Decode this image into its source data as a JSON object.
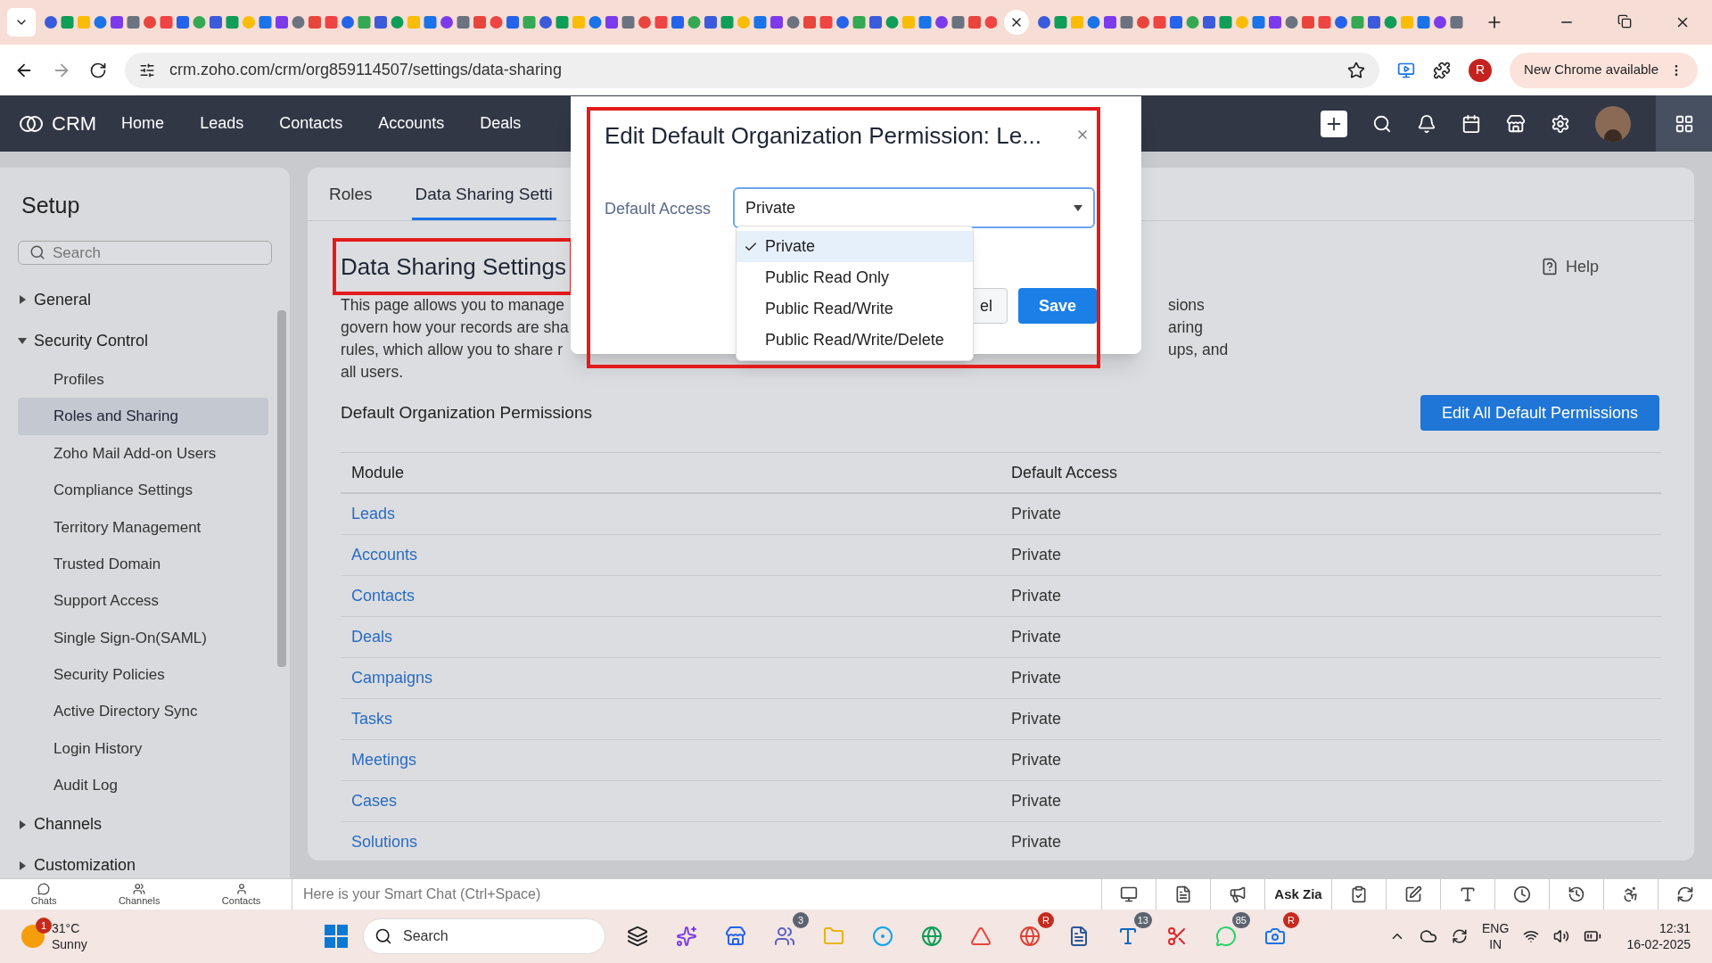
{
  "browser": {
    "url": "crm.zoho.com/crm/org859114507/settings/data-sharing",
    "update_label": "New Chrome available",
    "profile_initial": "R"
  },
  "app_nav": {
    "logo": "CRM",
    "items": [
      {
        "label": "Home"
      },
      {
        "label": "Leads"
      },
      {
        "label": "Contacts"
      },
      {
        "label": "Accounts"
      },
      {
        "label": "Deals"
      }
    ]
  },
  "sidebar": {
    "title": "Setup",
    "search_placeholder": "Search",
    "tree": [
      {
        "label": "General",
        "expanded": false
      },
      {
        "label": "Security Control",
        "expanded": true,
        "children": [
          {
            "label": "Profiles",
            "selected": false
          },
          {
            "label": "Roles and Sharing",
            "selected": true
          },
          {
            "label": "Zoho Mail Add-on Users",
            "selected": false
          },
          {
            "label": "Compliance Settings",
            "selected": false
          },
          {
            "label": "Territory Management",
            "selected": false
          },
          {
            "label": "Trusted Domain",
            "selected": false
          },
          {
            "label": "Support Access",
            "selected": false
          },
          {
            "label": "Single Sign-On(SAML)",
            "selected": false
          },
          {
            "label": "Security Policies",
            "selected": false
          },
          {
            "label": "Active Directory Sync",
            "selected": false
          },
          {
            "label": "Login History",
            "selected": false
          },
          {
            "label": "Audit Log",
            "selected": false
          }
        ]
      },
      {
        "label": "Channels",
        "expanded": false
      },
      {
        "label": "Customization",
        "expanded": false
      }
    ]
  },
  "content": {
    "tabs": [
      {
        "label": "Roles",
        "selected": false
      },
      {
        "label": "Data Sharing Setti",
        "selected": true
      }
    ],
    "heading": "Data Sharing Settings",
    "help": "Help",
    "description_left": [
      "This page allows you to manage",
      "govern how your records are sha",
      "rules, which allow you to share r",
      "all users."
    ],
    "description_right": [
      "sions",
      "aring",
      "ups, and"
    ],
    "section_title": "Default Organization Permissions",
    "edit_button": "Edit All Default Permissions",
    "table": {
      "columns": [
        "Module",
        "Default Access"
      ],
      "rows": [
        {
          "module": "Leads",
          "access": "Private"
        },
        {
          "module": "Accounts",
          "access": "Private"
        },
        {
          "module": "Contacts",
          "access": "Private"
        },
        {
          "module": "Deals",
          "access": "Private"
        },
        {
          "module": "Campaigns",
          "access": "Private"
        },
        {
          "module": "Tasks",
          "access": "Private"
        },
        {
          "module": "Meetings",
          "access": "Private"
        },
        {
          "module": "Cases",
          "access": "Private"
        },
        {
          "module": "Solutions",
          "access": "Private"
        }
      ]
    }
  },
  "dialog": {
    "title": "Edit Default Organization Permission: Le...",
    "field_label": "Default Access",
    "value": "Private",
    "options": [
      {
        "label": "Private",
        "selected": true
      },
      {
        "label": "Public Read Only",
        "selected": false
      },
      {
        "label": "Public Read/Write",
        "selected": false
      },
      {
        "label": "Public Read/Write/Delete",
        "selected": false
      }
    ],
    "buttons": [
      {
        "label": "el",
        "kind": "secondary"
      },
      {
        "label": "Save",
        "kind": "primary"
      }
    ]
  },
  "smart_chat": {
    "tabs": [
      {
        "label": "Chats",
        "kind": "chats"
      },
      {
        "label": "Channels",
        "kind": "channels"
      },
      {
        "label": "Contacts",
        "kind": "contacts"
      }
    ],
    "placeholder": "Here is your Smart Chat (Ctrl+Space)",
    "ask_zia": "Ask Zia"
  },
  "taskbar": {
    "weather": {
      "temp": "31°C",
      "condition": "Sunny",
      "badge": "1"
    },
    "search_placeholder": "Search",
    "apps": [
      {
        "kind": "taskview"
      },
      {
        "kind": "copilot"
      },
      {
        "kind": "store"
      },
      {
        "kind": "teams",
        "badge": "3"
      },
      {
        "kind": "files"
      },
      {
        "kind": "cortana"
      },
      {
        "kind": "edge"
      },
      {
        "kind": "office"
      },
      {
        "kind": "chrome",
        "badge": "R"
      },
      {
        "kind": "word"
      },
      {
        "kind": "linkedin",
        "badge": "13"
      },
      {
        "kind": "snip"
      },
      {
        "kind": "whatsapp",
        "badge": "85"
      },
      {
        "kind": "camera",
        "badge": "R"
      }
    ],
    "language": "ENG",
    "region": "IN",
    "time": "12:31",
    "date": "16-02-2025"
  }
}
